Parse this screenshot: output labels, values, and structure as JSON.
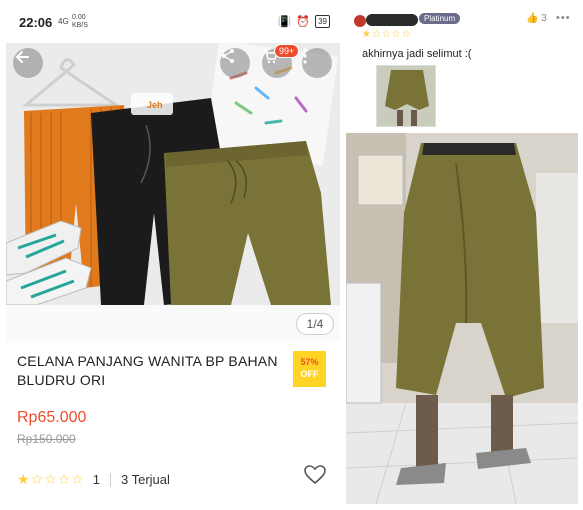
{
  "status_bar": {
    "time": "22:06",
    "signal": "4G",
    "net_speed": "0.00",
    "net_unit": "KB/S",
    "battery": "39"
  },
  "product": {
    "cart_badge": "99+",
    "photo_watermark": "Jeh",
    "page_indicator": "1/4",
    "title": "CELANA PANJANG WANITA BP BAHAN BLUDRU ORI",
    "discount_pct": "57%",
    "discount_label": "OFF",
    "price": "Rp65.000",
    "old_price": "Rp150.000",
    "stars": "★☆☆☆☆",
    "rating_value": "1",
    "sold": "3 Terjual"
  },
  "review": {
    "badge": "Platinum",
    "likes": "3",
    "stars": "★☆☆☆☆",
    "text": "akhirnya jadi selimut :("
  },
  "colors": {
    "accent": "#ee4d2d",
    "discount_bg": "#ffd424",
    "star": "#ffce3d",
    "olive": "#7a7338",
    "orange": "#e07a1c",
    "black_pants": "#1b1b1b"
  }
}
